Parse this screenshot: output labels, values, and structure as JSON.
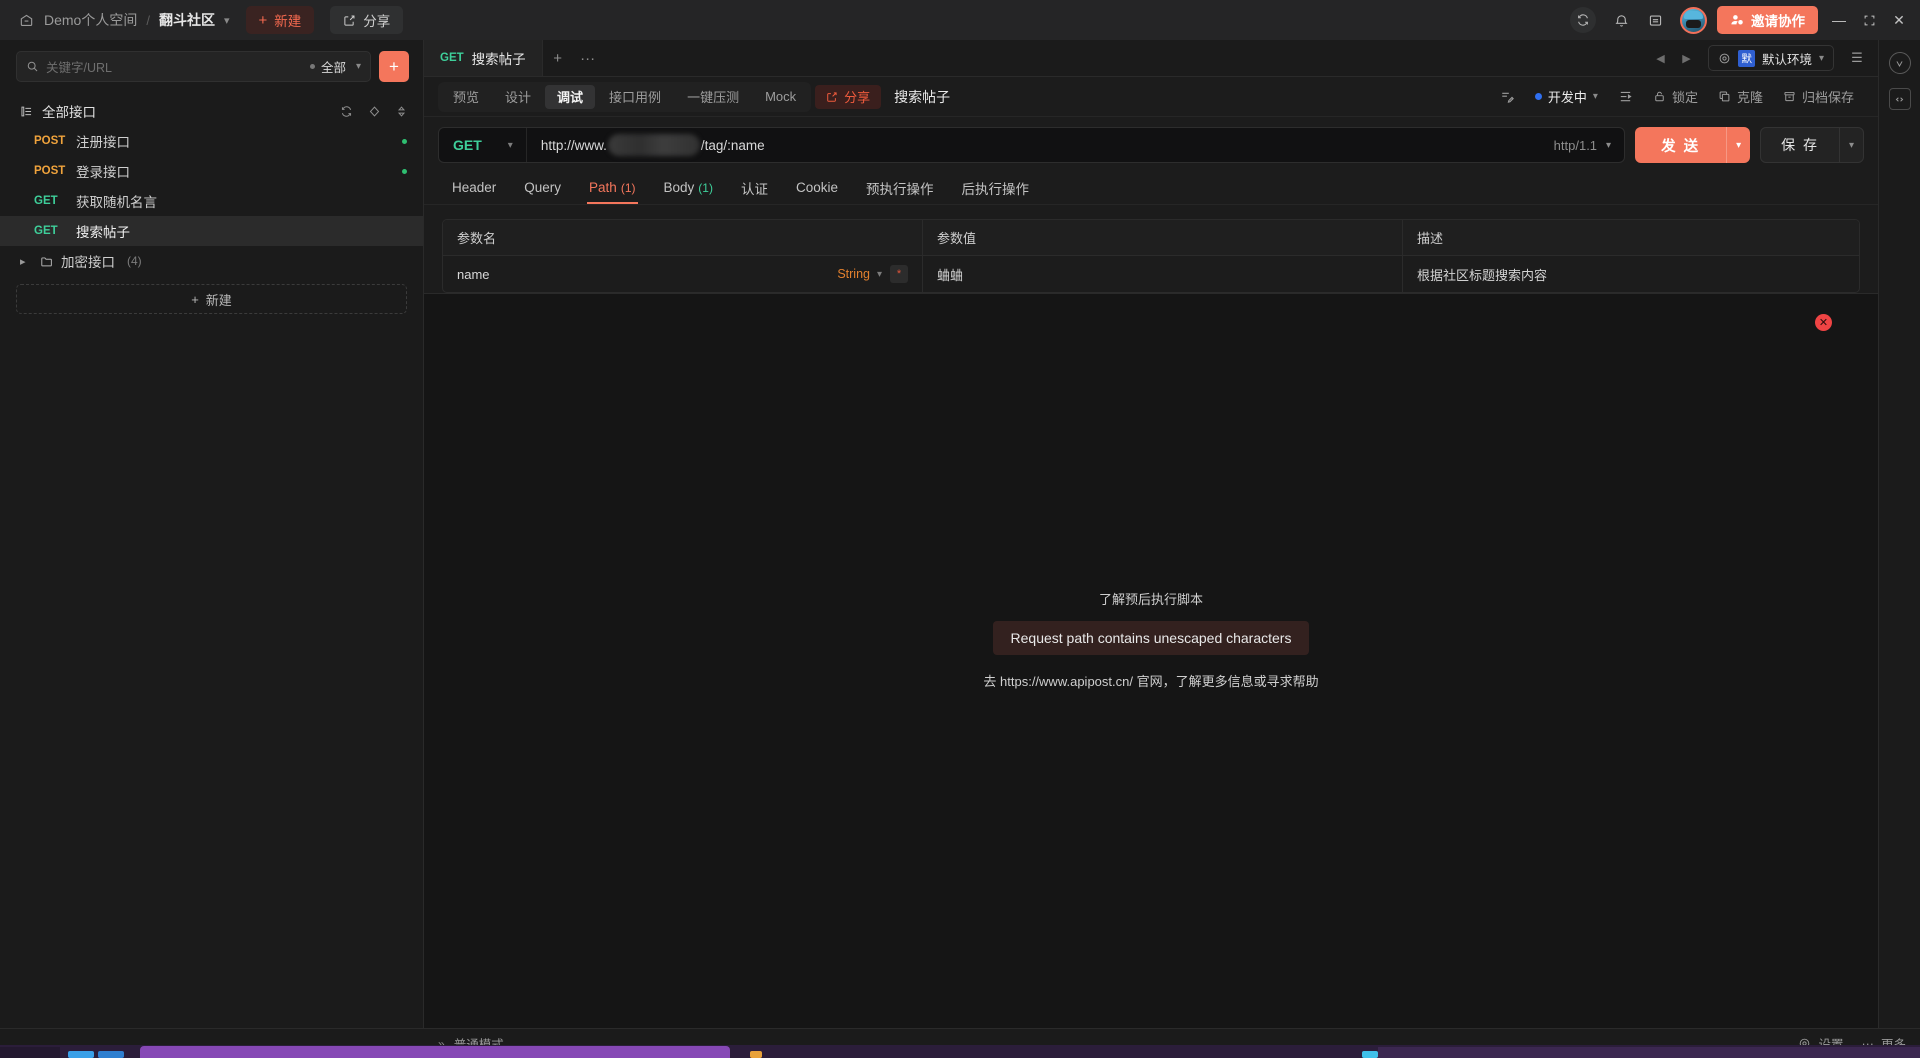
{
  "titlebar": {
    "workspace_icon": "workspace-icon",
    "workspace": "Demo个人空间",
    "separator": "/",
    "project": "翻斗社区",
    "new_button": "新建",
    "share_button": "分享",
    "invite_button": "邀请协作",
    "icons": [
      "sync-icon",
      "bell-icon",
      "panel-icon"
    ],
    "window_controls": [
      "minimize",
      "maximize",
      "close"
    ]
  },
  "sidebar": {
    "search": {
      "placeholder": "关键字/URL",
      "filter_label": "全部"
    },
    "add_button": "+",
    "group": {
      "title": "全部接口"
    },
    "items": [
      {
        "method": "POST",
        "name": "注册接口",
        "has_dot": true,
        "active": false
      },
      {
        "method": "POST",
        "name": "登录接口",
        "has_dot": true,
        "active": false
      },
      {
        "method": "GET",
        "name": "获取随机名言",
        "has_dot": false,
        "active": false
      },
      {
        "method": "GET",
        "name": "搜索帖子",
        "has_dot": false,
        "active": true
      }
    ],
    "folder": {
      "name": "加密接口",
      "count": "(4)"
    },
    "new_item": "新建"
  },
  "tabbar": {
    "tabs": [
      {
        "method": "GET",
        "label": "搜索帖子"
      }
    ],
    "add": "+",
    "more": "···",
    "env": {
      "badge": "默",
      "name": "默认环境"
    }
  },
  "toolbar": {
    "segments": [
      "预览",
      "设计",
      "调试",
      "接口用例",
      "一键压测",
      "Mock"
    ],
    "active_segment": "调试",
    "share": "分享",
    "title": "搜索帖子",
    "status": "开发中",
    "lock": "锁定",
    "clone": "克隆",
    "archive": "归档保存"
  },
  "request": {
    "method": "GET",
    "url_prefix": "http://www.",
    "url_redacted": true,
    "url_suffix": "/tag/:name",
    "http_version": "http/1.1",
    "send_label": "发 送",
    "save_label": "保 存"
  },
  "param_tabs": [
    {
      "label": "Header",
      "count": "",
      "active": false
    },
    {
      "label": "Query",
      "count": "",
      "active": false
    },
    {
      "label": "Path",
      "count": "(1)",
      "active": true
    },
    {
      "label": "Body",
      "count": "(1)",
      "active": false
    },
    {
      "label": "认证",
      "count": "",
      "active": false
    },
    {
      "label": "Cookie",
      "count": "",
      "active": false
    },
    {
      "label": "预执行操作",
      "count": "",
      "active": false
    },
    {
      "label": "后执行操作",
      "count": "",
      "active": false
    }
  ],
  "param_table": {
    "headers": [
      "参数名",
      "参数值",
      "描述"
    ],
    "rows": [
      {
        "name": "name",
        "type": "String",
        "required": "*",
        "value": "蛐蛐",
        "description": "根据社区标题搜索内容"
      }
    ]
  },
  "response": {
    "hint": "了解预后执行脚本",
    "error": "Request path contains unescaped characters",
    "footer": "去 https://www.apipost.cn/ 官网，了解更多信息或寻求帮助"
  },
  "statusbar": {
    "mode": "普通模式",
    "settings": "设置",
    "more": "更多"
  },
  "colors": {
    "accent": "#f4765c",
    "get_green": "#3ecf9a",
    "post_orange": "#f0a33c",
    "status_blue": "#2f6ff0",
    "error_red": "#ef4444",
    "type_orange": "#e2802e"
  }
}
